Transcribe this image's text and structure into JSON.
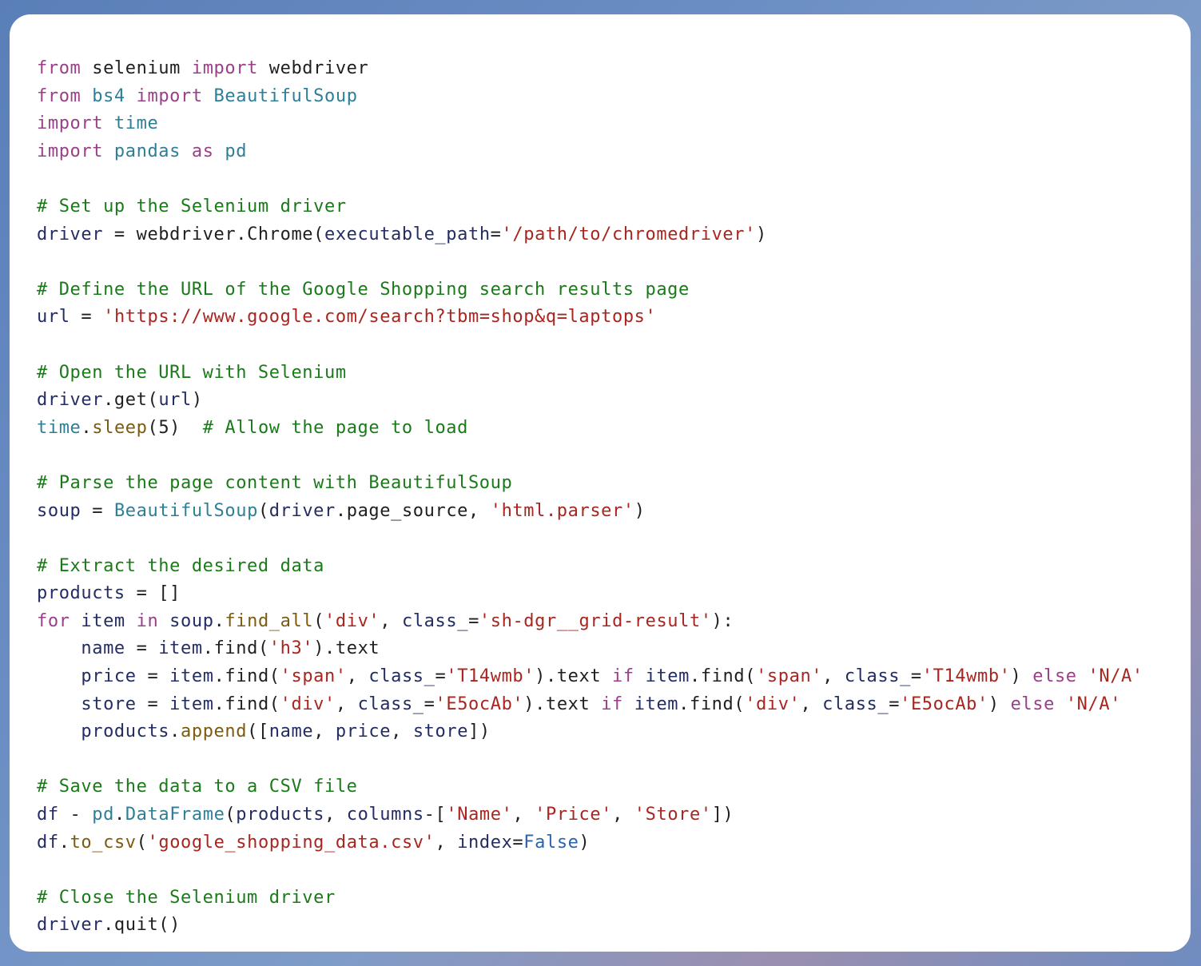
{
  "lines": [
    [
      {
        "t": "kw",
        "v": "from"
      },
      {
        "t": "pl",
        "v": " selenium "
      },
      {
        "t": "kw",
        "v": "import"
      },
      {
        "t": "pl",
        "v": " webdriver"
      }
    ],
    [
      {
        "t": "kw",
        "v": "from"
      },
      {
        "t": "mod",
        "v": " bs4 "
      },
      {
        "t": "kw",
        "v": "import"
      },
      {
        "t": "mod",
        "v": " BeautifulSoup"
      }
    ],
    [
      {
        "t": "kw",
        "v": "import"
      },
      {
        "t": "mod",
        "v": " time"
      }
    ],
    [
      {
        "t": "kw",
        "v": "import"
      },
      {
        "t": "mod",
        "v": " pandas "
      },
      {
        "t": "kw",
        "v": "as"
      },
      {
        "t": "mod",
        "v": " pd"
      }
    ],
    [],
    [
      {
        "t": "cm",
        "v": "# Set up the Selenium driver"
      }
    ],
    [
      {
        "t": "var",
        "v": "driver"
      },
      {
        "t": "pl",
        "v": " = webdriver.Chrome("
      },
      {
        "t": "var",
        "v": "executable_path"
      },
      {
        "t": "pl",
        "v": "="
      },
      {
        "t": "st",
        "v": "'/path/to/chromedriver'"
      },
      {
        "t": "pl",
        "v": ")"
      }
    ],
    [],
    [
      {
        "t": "cm",
        "v": "# Define the URL of the Google Shopping search results page"
      }
    ],
    [
      {
        "t": "var",
        "v": "url"
      },
      {
        "t": "pl",
        "v": " = "
      },
      {
        "t": "st",
        "v": "'https://www.google.com/search?tbm=shop&q=laptops'"
      }
    ],
    [],
    [
      {
        "t": "cm",
        "v": "# Open the URL with Selenium"
      }
    ],
    [
      {
        "t": "var",
        "v": "driver"
      },
      {
        "t": "pl",
        "v": ".get("
      },
      {
        "t": "var",
        "v": "url"
      },
      {
        "t": "pl",
        "v": ")"
      }
    ],
    [
      {
        "t": "mod",
        "v": "time"
      },
      {
        "t": "pl",
        "v": "."
      },
      {
        "t": "fn",
        "v": "sleep"
      },
      {
        "t": "pl",
        "v": "(5)  "
      },
      {
        "t": "cm",
        "v": "# Allow the page to load"
      }
    ],
    [],
    [
      {
        "t": "cm",
        "v": "# Parse the page content with BeautifulSoup"
      }
    ],
    [
      {
        "t": "var",
        "v": "soup"
      },
      {
        "t": "pl",
        "v": " = "
      },
      {
        "t": "mod",
        "v": "BeautifulSoup"
      },
      {
        "t": "pl",
        "v": "("
      },
      {
        "t": "var",
        "v": "driver"
      },
      {
        "t": "pl",
        "v": ".page_source, "
      },
      {
        "t": "st",
        "v": "'html.parser'"
      },
      {
        "t": "pl",
        "v": ")"
      }
    ],
    [],
    [
      {
        "t": "cm",
        "v": "# Extract the desired data"
      }
    ],
    [
      {
        "t": "var",
        "v": "products"
      },
      {
        "t": "pl",
        "v": " = []"
      }
    ],
    [
      {
        "t": "kw",
        "v": "for"
      },
      {
        "t": "var",
        "v": " item "
      },
      {
        "t": "kw",
        "v": "in"
      },
      {
        "t": "var",
        "v": " soup"
      },
      {
        "t": "pl",
        "v": "."
      },
      {
        "t": "fn",
        "v": "find_all"
      },
      {
        "t": "pl",
        "v": "("
      },
      {
        "t": "st",
        "v": "'div'"
      },
      {
        "t": "pl",
        "v": ", "
      },
      {
        "t": "var",
        "v": "class_"
      },
      {
        "t": "pl",
        "v": "="
      },
      {
        "t": "st",
        "v": "'sh-dgr__grid-result'"
      },
      {
        "t": "pl",
        "v": "):"
      }
    ],
    [
      {
        "t": "pl",
        "v": "    "
      },
      {
        "t": "var",
        "v": "name"
      },
      {
        "t": "pl",
        "v": " = "
      },
      {
        "t": "var",
        "v": "item"
      },
      {
        "t": "pl",
        "v": ".find("
      },
      {
        "t": "st",
        "v": "'h3'"
      },
      {
        "t": "pl",
        "v": ").text"
      }
    ],
    [
      {
        "t": "pl",
        "v": "    "
      },
      {
        "t": "var",
        "v": "price"
      },
      {
        "t": "pl",
        "v": " = "
      },
      {
        "t": "var",
        "v": "item"
      },
      {
        "t": "pl",
        "v": ".find("
      },
      {
        "t": "st",
        "v": "'span'"
      },
      {
        "t": "pl",
        "v": ", "
      },
      {
        "t": "var",
        "v": "class_"
      },
      {
        "t": "pl",
        "v": "="
      },
      {
        "t": "st",
        "v": "'T14wmb'"
      },
      {
        "t": "pl",
        "v": ").text "
      },
      {
        "t": "kw",
        "v": "if"
      },
      {
        "t": "var",
        "v": " item"
      },
      {
        "t": "pl",
        "v": ".find("
      },
      {
        "t": "st",
        "v": "'span'"
      },
      {
        "t": "pl",
        "v": ", "
      },
      {
        "t": "var",
        "v": "class_"
      },
      {
        "t": "pl",
        "v": "="
      },
      {
        "t": "st",
        "v": "'T14wmb'"
      },
      {
        "t": "pl",
        "v": ") "
      },
      {
        "t": "kw",
        "v": "else"
      },
      {
        "t": "pl",
        "v": " "
      },
      {
        "t": "st",
        "v": "'N/A'"
      }
    ],
    [
      {
        "t": "pl",
        "v": "    "
      },
      {
        "t": "var",
        "v": "store"
      },
      {
        "t": "pl",
        "v": " = "
      },
      {
        "t": "var",
        "v": "item"
      },
      {
        "t": "pl",
        "v": ".find("
      },
      {
        "t": "st",
        "v": "'div'"
      },
      {
        "t": "pl",
        "v": ", "
      },
      {
        "t": "var",
        "v": "class_"
      },
      {
        "t": "pl",
        "v": "="
      },
      {
        "t": "st",
        "v": "'E5ocAb'"
      },
      {
        "t": "pl",
        "v": ").text "
      },
      {
        "t": "kw",
        "v": "if"
      },
      {
        "t": "var",
        "v": " item"
      },
      {
        "t": "pl",
        "v": ".find("
      },
      {
        "t": "st",
        "v": "'div'"
      },
      {
        "t": "pl",
        "v": ", "
      },
      {
        "t": "var",
        "v": "class_"
      },
      {
        "t": "pl",
        "v": "="
      },
      {
        "t": "st",
        "v": "'E5ocAb'"
      },
      {
        "t": "pl",
        "v": ") "
      },
      {
        "t": "kw",
        "v": "else"
      },
      {
        "t": "pl",
        "v": " "
      },
      {
        "t": "st",
        "v": "'N/A'"
      }
    ],
    [
      {
        "t": "pl",
        "v": "    "
      },
      {
        "t": "var",
        "v": "products"
      },
      {
        "t": "pl",
        "v": "."
      },
      {
        "t": "fn",
        "v": "append"
      },
      {
        "t": "pl",
        "v": "(["
      },
      {
        "t": "var",
        "v": "name"
      },
      {
        "t": "pl",
        "v": ", "
      },
      {
        "t": "var",
        "v": "price"
      },
      {
        "t": "pl",
        "v": ", "
      },
      {
        "t": "var",
        "v": "store"
      },
      {
        "t": "pl",
        "v": "])"
      }
    ],
    [],
    [
      {
        "t": "cm",
        "v": "# Save the data to a CSV file"
      }
    ],
    [
      {
        "t": "var",
        "v": "df"
      },
      {
        "t": "pl",
        "v": " - "
      },
      {
        "t": "mod",
        "v": "pd"
      },
      {
        "t": "pl",
        "v": "."
      },
      {
        "t": "mod",
        "v": "DataFrame"
      },
      {
        "t": "pl",
        "v": "("
      },
      {
        "t": "var",
        "v": "products"
      },
      {
        "t": "pl",
        "v": ", "
      },
      {
        "t": "var",
        "v": "columns"
      },
      {
        "t": "pl",
        "v": "-["
      },
      {
        "t": "st",
        "v": "'Name'"
      },
      {
        "t": "pl",
        "v": ", "
      },
      {
        "t": "st",
        "v": "'Price'"
      },
      {
        "t": "pl",
        "v": ", "
      },
      {
        "t": "st",
        "v": "'Store'"
      },
      {
        "t": "pl",
        "v": "])"
      }
    ],
    [
      {
        "t": "var",
        "v": "df"
      },
      {
        "t": "pl",
        "v": "."
      },
      {
        "t": "fn",
        "v": "to_csv"
      },
      {
        "t": "pl",
        "v": "("
      },
      {
        "t": "st",
        "v": "'google_shopping_data.csv'"
      },
      {
        "t": "pl",
        "v": ", "
      },
      {
        "t": "var",
        "v": "index"
      },
      {
        "t": "pl",
        "v": "="
      },
      {
        "t": "bi",
        "v": "False"
      },
      {
        "t": "pl",
        "v": ")"
      }
    ],
    [],
    [
      {
        "t": "cm",
        "v": "# Close the Selenium driver"
      }
    ],
    [
      {
        "t": "var",
        "v": "driver"
      },
      {
        "t": "pl",
        "v": ".quit()"
      }
    ]
  ]
}
